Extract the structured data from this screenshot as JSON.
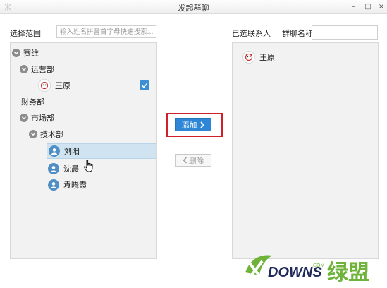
{
  "window": {
    "title": "发起群聊",
    "minimize_symbol": "–",
    "maximize_symbol": "□",
    "close_symbol": "×",
    "app_icon": "app-logo-icon"
  },
  "left": {
    "scope_label": "选择范围",
    "search_placeholder": "输入姓名拼音首字母快速搜索...",
    "tree": {
      "root": "赛维",
      "dept_ops": "运营部",
      "member_wangyuan": "王原",
      "dept_finance": "财务部",
      "dept_market": "市场部",
      "dept_tech": "技术部",
      "member_liuyang": "刘阳",
      "member_shenchen": "沈晨",
      "member_yuanxiaoxia": "袁晓霞"
    },
    "wangyuan_checked": true
  },
  "buttons": {
    "add": "添加",
    "delete": "删除",
    "add_icon": "chevron-right-icon",
    "delete_icon": "chevron-left-icon"
  },
  "right": {
    "selected_label": "已选联系人",
    "group_name_label": "群聊名称",
    "group_name_value": "",
    "selected_contacts": [
      "王原"
    ]
  },
  "watermark": {
    "brand": "DOWNS",
    "suffix": ".COM",
    "logo_text": "绿盟"
  },
  "colors": {
    "accent": "#2e86d6",
    "highlight_border": "#d0202a",
    "selection": "#cfe3f1",
    "panel_bg": "#f2f2f2"
  }
}
